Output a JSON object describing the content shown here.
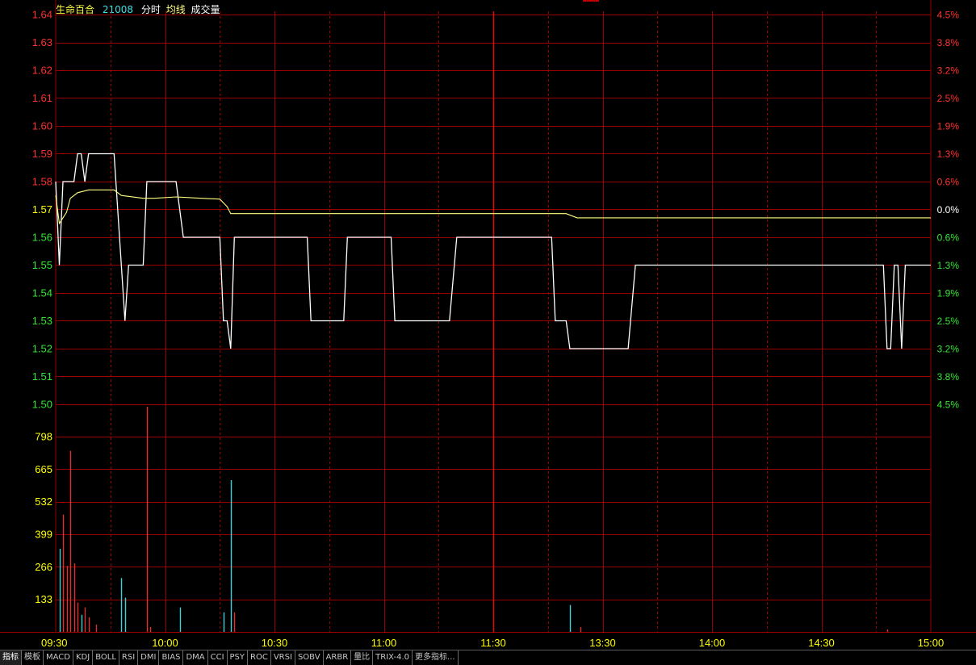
{
  "header": {
    "stock_name": "生命百合",
    "stock_code": "21008",
    "labels": [
      "分时",
      "均线",
      "成交量"
    ]
  },
  "colors": {
    "grid": "#9a0000",
    "up": "#ff3030",
    "down": "#33e633",
    "flat": "#ffff00",
    "price_line": "#ffffff",
    "avg_line": "#ffff80",
    "vol_up": "#e03030",
    "vol_down": "#40d0d8",
    "time_label": "#ffff00"
  },
  "tabs": [
    "指标",
    "模板",
    "MACD",
    "KDJ",
    "BOLL",
    "RSI",
    "DMI",
    "BIAS",
    "DMA",
    "CCI",
    "PSY",
    "ROC",
    "VRSI",
    "SOBV",
    "ARBR",
    "量比",
    "TRIX-4.0",
    "更多指标..."
  ],
  "chart_data": {
    "type": "line",
    "title": "",
    "prev_close": 1.57,
    "price_axis": {
      "ticks": [
        1.64,
        1.63,
        1.62,
        1.61,
        1.6,
        1.59,
        1.58,
        1.57,
        1.56,
        1.55,
        1.54,
        1.53,
        1.52,
        1.51,
        1.5
      ],
      "tick_labels": [
        "1.64",
        "1.63",
        "1.62",
        "1.61",
        "1.60",
        "1.59",
        "1.58",
        "1.57",
        "1.56",
        "1.55",
        "1.54",
        "1.53",
        "1.52",
        "1.51",
        "1.50"
      ],
      "ylim": [
        1.5,
        1.64
      ]
    },
    "percent_axis": {
      "labels": [
        "4.5%",
        "3.8%",
        "3.2%",
        "2.5%",
        "1.9%",
        "1.3%",
        "0.6%",
        "0.0%",
        "0.6%",
        "1.3%",
        "1.9%",
        "2.5%",
        "3.2%",
        "3.8%",
        "4.5%"
      ]
    },
    "volume_axis": {
      "tick_labels": [
        "798",
        "665",
        "532",
        "399",
        "266",
        "133"
      ],
      "ticks": [
        798,
        665,
        532,
        399,
        266,
        133
      ],
      "ylim": [
        0,
        930
      ]
    },
    "time_axis": {
      "labels": [
        "09:30",
        "10:00",
        "10:30",
        "11:00",
        "11:30",
        "13:30",
        "14:00",
        "14:30",
        "15:00"
      ],
      "minutes": [
        0,
        30,
        60,
        90,
        120,
        150,
        180,
        210,
        240
      ],
      "total_minutes": 240
    },
    "series": [
      {
        "id": "price",
        "points": [
          [
            0,
            1.58
          ],
          [
            1,
            1.55
          ],
          [
            2,
            1.58
          ],
          [
            5,
            1.58
          ],
          [
            6,
            1.59
          ],
          [
            7,
            1.59
          ],
          [
            8,
            1.58
          ],
          [
            9,
            1.59
          ],
          [
            16,
            1.59
          ],
          [
            19,
            1.53
          ],
          [
            20,
            1.55
          ],
          [
            24,
            1.55
          ],
          [
            25,
            1.58
          ],
          [
            33,
            1.58
          ],
          [
            35,
            1.56
          ],
          [
            45,
            1.56
          ],
          [
            46,
            1.53
          ],
          [
            47,
            1.53
          ],
          [
            48,
            1.52
          ],
          [
            49,
            1.56
          ],
          [
            69,
            1.56
          ],
          [
            70,
            1.53
          ],
          [
            79,
            1.53
          ],
          [
            80,
            1.56
          ],
          [
            92,
            1.56
          ],
          [
            93,
            1.53
          ],
          [
            108,
            1.53
          ],
          [
            110,
            1.56
          ],
          [
            136,
            1.56
          ],
          [
            137,
            1.53
          ],
          [
            140,
            1.53
          ],
          [
            141,
            1.52
          ],
          [
            157,
            1.52
          ],
          [
            159,
            1.55
          ],
          [
            227,
            1.55
          ],
          [
            228,
            1.52
          ],
          [
            229,
            1.52
          ],
          [
            230,
            1.55
          ],
          [
            231,
            1.55
          ],
          [
            232,
            1.52
          ],
          [
            233,
            1.55
          ],
          [
            240,
            1.55
          ]
        ]
      },
      {
        "id": "average",
        "points": [
          [
            0,
            1.575
          ],
          [
            1,
            1.565
          ],
          [
            2,
            1.567
          ],
          [
            3,
            1.569
          ],
          [
            4,
            1.574
          ],
          [
            6,
            1.576
          ],
          [
            9,
            1.577
          ],
          [
            13,
            1.577
          ],
          [
            16,
            1.577
          ],
          [
            18,
            1.575
          ],
          [
            24,
            1.574
          ],
          [
            27,
            1.574
          ],
          [
            33,
            1.5745
          ],
          [
            40,
            1.574
          ],
          [
            45,
            1.5737
          ],
          [
            47,
            1.571
          ],
          [
            48,
            1.5685
          ],
          [
            55,
            1.5685
          ],
          [
            120,
            1.5685
          ],
          [
            140,
            1.5685
          ],
          [
            143,
            1.567
          ],
          [
            240,
            1.567
          ]
        ]
      }
    ],
    "volume_bars": [
      {
        "minute": 1,
        "value": 340,
        "dir": "down"
      },
      {
        "minute": 2,
        "value": 480,
        "dir": "up"
      },
      {
        "minute": 3,
        "value": 270,
        "dir": "up"
      },
      {
        "minute": 4,
        "value": 740,
        "dir": "up"
      },
      {
        "minute": 5,
        "value": 280,
        "dir": "up"
      },
      {
        "minute": 6,
        "value": 120,
        "dir": "up"
      },
      {
        "minute": 7,
        "value": 70,
        "dir": "down"
      },
      {
        "minute": 8,
        "value": 100,
        "dir": "up"
      },
      {
        "minute": 9,
        "value": 60,
        "dir": "up"
      },
      {
        "minute": 11,
        "value": 30,
        "dir": "up"
      },
      {
        "minute": 18,
        "value": 220,
        "dir": "down"
      },
      {
        "minute": 19,
        "value": 140,
        "dir": "down"
      },
      {
        "minute": 25,
        "value": 920,
        "dir": "up"
      },
      {
        "minute": 26,
        "value": 20,
        "dir": "up"
      },
      {
        "minute": 34,
        "value": 100,
        "dir": "down"
      },
      {
        "minute": 46,
        "value": 80,
        "dir": "down"
      },
      {
        "minute": 48,
        "value": 620,
        "dir": "down"
      },
      {
        "minute": 49,
        "value": 80,
        "dir": "up"
      },
      {
        "minute": 141,
        "value": 110,
        "dir": "down"
      },
      {
        "minute": 144,
        "value": 20,
        "dir": "up"
      },
      {
        "minute": 228,
        "value": 10,
        "dir": "up"
      }
    ]
  }
}
